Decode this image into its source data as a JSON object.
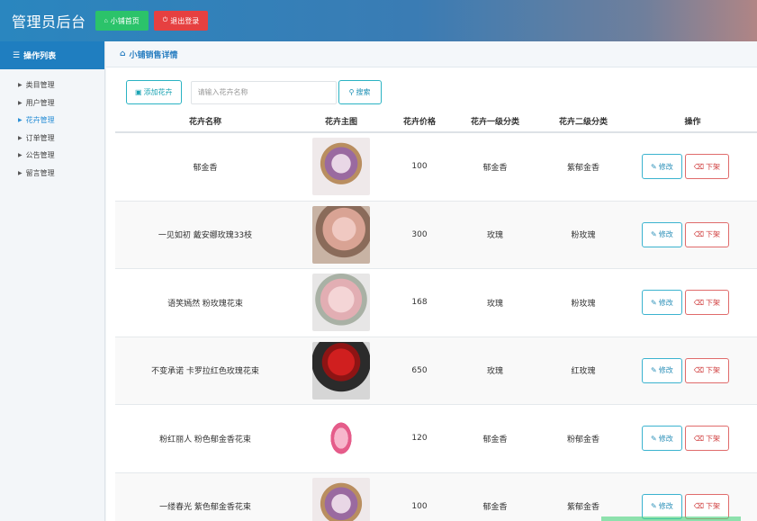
{
  "header": {
    "title": "管理员后台",
    "home_label": "小铺首页",
    "exit_label": "退出登录"
  },
  "sidebar": {
    "heading": "操作列表",
    "items": [
      {
        "label": "类目管理"
      },
      {
        "label": "用户管理"
      },
      {
        "label": "花卉管理"
      },
      {
        "label": "订单管理"
      },
      {
        "label": "公告管理"
      },
      {
        "label": "留言管理"
      }
    ],
    "active_index": 2
  },
  "main": {
    "breadcrumb": "小铺销售详情",
    "add_label": "添加花卉",
    "search_placeholder": "请输入花卉名称",
    "search_label": "搜索"
  },
  "table": {
    "columns": [
      "花卉名称",
      "花卉主图",
      "花卉价格",
      "花卉一级分类",
      "花卉二级分类",
      "操作"
    ],
    "edit_label": "修改",
    "off_label": "下架",
    "rows": [
      {
        "name": "郁金香",
        "price": "100",
        "cat1": "郁金香",
        "cat2": "紫郁金香"
      },
      {
        "name": "一见如初 戴安娜玫瑰33枝",
        "price": "300",
        "cat1": "玫瑰",
        "cat2": "粉玫瑰"
      },
      {
        "name": "语笑嫣然 粉玫瑰花束",
        "price": "168",
        "cat1": "玫瑰",
        "cat2": "粉玫瑰"
      },
      {
        "name": "不变承诺 卡罗拉红色玫瑰花束",
        "price": "650",
        "cat1": "玫瑰",
        "cat2": "红玫瑰"
      },
      {
        "name": "粉红丽人 粉色郁金香花束",
        "price": "120",
        "cat1": "郁金香",
        "cat2": "粉郁金香"
      },
      {
        "name": "一缕春光 紫色郁金香花束",
        "price": "100",
        "cat1": "郁金香",
        "cat2": "紫郁金香"
      }
    ]
  },
  "colors": {
    "header_blue": "#2a86bf",
    "home_green": "#2bc36a",
    "exit_red": "#e64040",
    "sidebar_head": "#1f7ec0",
    "accent_cyan": "#2ab3c3",
    "danger": "#d04040"
  }
}
